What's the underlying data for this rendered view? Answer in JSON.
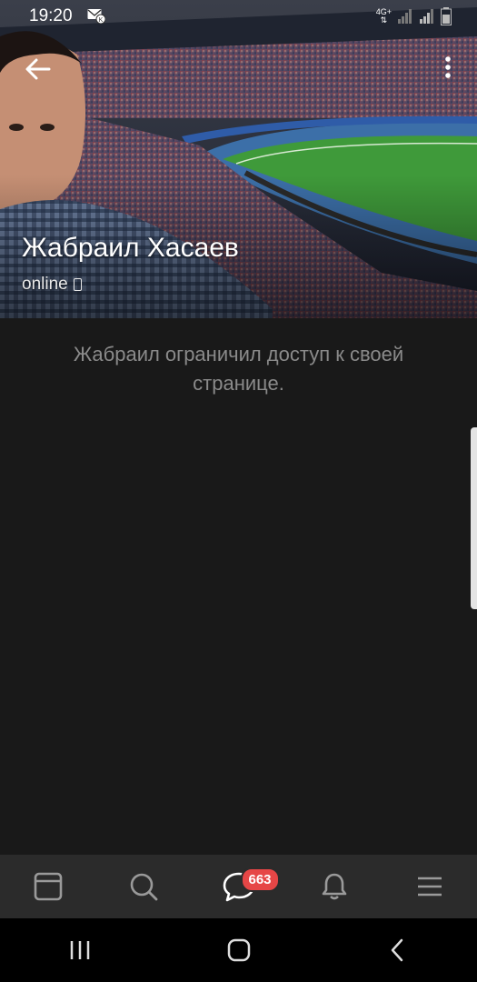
{
  "status_bar": {
    "time": "19:20",
    "network": "4G+"
  },
  "profile": {
    "name": "Жабраил Хасаев",
    "status": "online"
  },
  "content": {
    "restricted_message": "Жабраил ограничил доступ к своей странице."
  },
  "tabbar": {
    "messages_badge": "663",
    "tabs": [
      "feed-icon",
      "search-icon",
      "messages-icon",
      "notifications-icon",
      "menu-icon"
    ]
  },
  "colors": {
    "background": "#191919",
    "tabbar": "#2b2b2b",
    "badge": "#e64646",
    "muted_text": "#8a8a8a"
  }
}
